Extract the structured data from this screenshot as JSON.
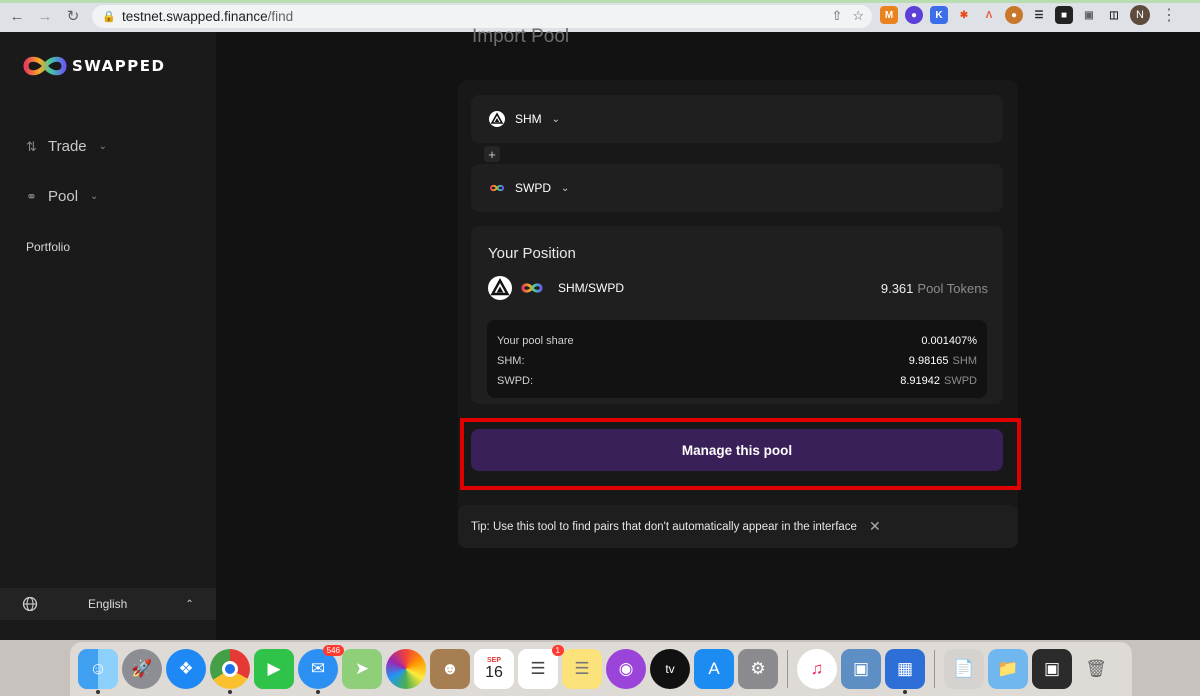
{
  "browser": {
    "url_host": "testnet.swapped.finance",
    "url_path": "/find",
    "profile_initial": "N"
  },
  "app": {
    "brand": "SWAPPED",
    "colors": {
      "accent_button": "#3a2059",
      "highlight": "#e00000"
    }
  },
  "sidebar": {
    "items": [
      {
        "label": "Trade",
        "icon": "swap-arrows-icon"
      },
      {
        "label": "Pool",
        "icon": "pool-icon"
      },
      {
        "label": "Portfolio"
      }
    ],
    "language": "English"
  },
  "main": {
    "title": "Import Pool",
    "token_a": {
      "symbol": "SHM",
      "icon": "shm-token-icon"
    },
    "token_b": {
      "symbol": "SWPD",
      "icon": "swpd-token-icon"
    },
    "plus": "+",
    "position": {
      "title": "Your Position",
      "pair": "SHM/SWPD",
      "pool_tokens_value": "9.361",
      "pool_tokens_unit": "Pool Tokens",
      "share_label": "Your pool share",
      "share_value": "0.001407%",
      "shm_label": "SHM:",
      "shm_value": "9.98165",
      "shm_unit": "SHM",
      "swpd_label": "SWPD:",
      "swpd_value": "8.91942",
      "swpd_unit": "SWPD"
    },
    "manage_button": "Manage this pool",
    "tip": "Tip: Use this tool to find pairs that don't automatically appear in the interface"
  },
  "dock": {
    "messages_badge": "546",
    "calendar_month": "SEP",
    "calendar_day": "16",
    "reminders_badge": "1",
    "tv_label": "tv"
  }
}
